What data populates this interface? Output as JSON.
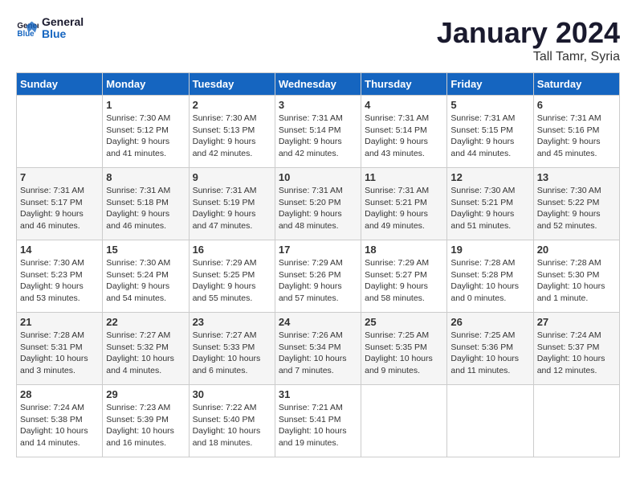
{
  "header": {
    "logo_line1": "General",
    "logo_line2": "Blue",
    "month_title": "January 2024",
    "subtitle": "Tall Tamr, Syria"
  },
  "weekdays": [
    "Sunday",
    "Monday",
    "Tuesday",
    "Wednesday",
    "Thursday",
    "Friday",
    "Saturday"
  ],
  "weeks": [
    [
      {
        "day": "",
        "lines": []
      },
      {
        "day": "1",
        "lines": [
          "Sunrise: 7:30 AM",
          "Sunset: 5:12 PM",
          "Daylight: 9 hours",
          "and 41 minutes."
        ]
      },
      {
        "day": "2",
        "lines": [
          "Sunrise: 7:30 AM",
          "Sunset: 5:13 PM",
          "Daylight: 9 hours",
          "and 42 minutes."
        ]
      },
      {
        "day": "3",
        "lines": [
          "Sunrise: 7:31 AM",
          "Sunset: 5:14 PM",
          "Daylight: 9 hours",
          "and 42 minutes."
        ]
      },
      {
        "day": "4",
        "lines": [
          "Sunrise: 7:31 AM",
          "Sunset: 5:14 PM",
          "Daylight: 9 hours",
          "and 43 minutes."
        ]
      },
      {
        "day": "5",
        "lines": [
          "Sunrise: 7:31 AM",
          "Sunset: 5:15 PM",
          "Daylight: 9 hours",
          "and 44 minutes."
        ]
      },
      {
        "day": "6",
        "lines": [
          "Sunrise: 7:31 AM",
          "Sunset: 5:16 PM",
          "Daylight: 9 hours",
          "and 45 minutes."
        ]
      }
    ],
    [
      {
        "day": "7",
        "lines": [
          "Sunrise: 7:31 AM",
          "Sunset: 5:17 PM",
          "Daylight: 9 hours",
          "and 46 minutes."
        ]
      },
      {
        "day": "8",
        "lines": [
          "Sunrise: 7:31 AM",
          "Sunset: 5:18 PM",
          "Daylight: 9 hours",
          "and 46 minutes."
        ]
      },
      {
        "day": "9",
        "lines": [
          "Sunrise: 7:31 AM",
          "Sunset: 5:19 PM",
          "Daylight: 9 hours",
          "and 47 minutes."
        ]
      },
      {
        "day": "10",
        "lines": [
          "Sunrise: 7:31 AM",
          "Sunset: 5:20 PM",
          "Daylight: 9 hours",
          "and 48 minutes."
        ]
      },
      {
        "day": "11",
        "lines": [
          "Sunrise: 7:31 AM",
          "Sunset: 5:21 PM",
          "Daylight: 9 hours",
          "and 49 minutes."
        ]
      },
      {
        "day": "12",
        "lines": [
          "Sunrise: 7:30 AM",
          "Sunset: 5:21 PM",
          "Daylight: 9 hours",
          "and 51 minutes."
        ]
      },
      {
        "day": "13",
        "lines": [
          "Sunrise: 7:30 AM",
          "Sunset: 5:22 PM",
          "Daylight: 9 hours",
          "and 52 minutes."
        ]
      }
    ],
    [
      {
        "day": "14",
        "lines": [
          "Sunrise: 7:30 AM",
          "Sunset: 5:23 PM",
          "Daylight: 9 hours",
          "and 53 minutes."
        ]
      },
      {
        "day": "15",
        "lines": [
          "Sunrise: 7:30 AM",
          "Sunset: 5:24 PM",
          "Daylight: 9 hours",
          "and 54 minutes."
        ]
      },
      {
        "day": "16",
        "lines": [
          "Sunrise: 7:29 AM",
          "Sunset: 5:25 PM",
          "Daylight: 9 hours",
          "and 55 minutes."
        ]
      },
      {
        "day": "17",
        "lines": [
          "Sunrise: 7:29 AM",
          "Sunset: 5:26 PM",
          "Daylight: 9 hours",
          "and 57 minutes."
        ]
      },
      {
        "day": "18",
        "lines": [
          "Sunrise: 7:29 AM",
          "Sunset: 5:27 PM",
          "Daylight: 9 hours",
          "and 58 minutes."
        ]
      },
      {
        "day": "19",
        "lines": [
          "Sunrise: 7:28 AM",
          "Sunset: 5:28 PM",
          "Daylight: 10 hours",
          "and 0 minutes."
        ]
      },
      {
        "day": "20",
        "lines": [
          "Sunrise: 7:28 AM",
          "Sunset: 5:30 PM",
          "Daylight: 10 hours",
          "and 1 minute."
        ]
      }
    ],
    [
      {
        "day": "21",
        "lines": [
          "Sunrise: 7:28 AM",
          "Sunset: 5:31 PM",
          "Daylight: 10 hours",
          "and 3 minutes."
        ]
      },
      {
        "day": "22",
        "lines": [
          "Sunrise: 7:27 AM",
          "Sunset: 5:32 PM",
          "Daylight: 10 hours",
          "and 4 minutes."
        ]
      },
      {
        "day": "23",
        "lines": [
          "Sunrise: 7:27 AM",
          "Sunset: 5:33 PM",
          "Daylight: 10 hours",
          "and 6 minutes."
        ]
      },
      {
        "day": "24",
        "lines": [
          "Sunrise: 7:26 AM",
          "Sunset: 5:34 PM",
          "Daylight: 10 hours",
          "and 7 minutes."
        ]
      },
      {
        "day": "25",
        "lines": [
          "Sunrise: 7:25 AM",
          "Sunset: 5:35 PM",
          "Daylight: 10 hours",
          "and 9 minutes."
        ]
      },
      {
        "day": "26",
        "lines": [
          "Sunrise: 7:25 AM",
          "Sunset: 5:36 PM",
          "Daylight: 10 hours",
          "and 11 minutes."
        ]
      },
      {
        "day": "27",
        "lines": [
          "Sunrise: 7:24 AM",
          "Sunset: 5:37 PM",
          "Daylight: 10 hours",
          "and 12 minutes."
        ]
      }
    ],
    [
      {
        "day": "28",
        "lines": [
          "Sunrise: 7:24 AM",
          "Sunset: 5:38 PM",
          "Daylight: 10 hours",
          "and 14 minutes."
        ]
      },
      {
        "day": "29",
        "lines": [
          "Sunrise: 7:23 AM",
          "Sunset: 5:39 PM",
          "Daylight: 10 hours",
          "and 16 minutes."
        ]
      },
      {
        "day": "30",
        "lines": [
          "Sunrise: 7:22 AM",
          "Sunset: 5:40 PM",
          "Daylight: 10 hours",
          "and 18 minutes."
        ]
      },
      {
        "day": "31",
        "lines": [
          "Sunrise: 7:21 AM",
          "Sunset: 5:41 PM",
          "Daylight: 10 hours",
          "and 19 minutes."
        ]
      },
      {
        "day": "",
        "lines": []
      },
      {
        "day": "",
        "lines": []
      },
      {
        "day": "",
        "lines": []
      }
    ]
  ]
}
